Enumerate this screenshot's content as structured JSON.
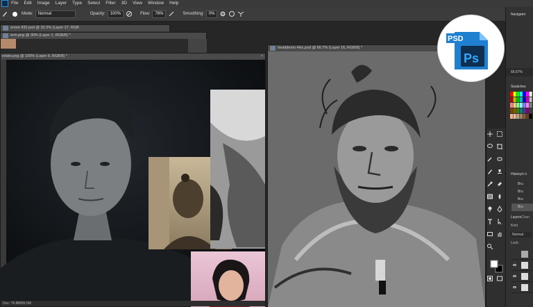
{
  "menubar": {
    "items": [
      "File",
      "Edit",
      "Image",
      "Layer",
      "Type",
      "Select",
      "Filter",
      "3D",
      "View",
      "Window",
      "Help"
    ]
  },
  "options": {
    "mode_label": "Mode:",
    "mode_value": "Normal",
    "opacity_label": "Opacity:",
    "opacity_value": "100%",
    "flow_label": "Flow:",
    "flow_value": "76%",
    "smoothing_label": "Smoothing:",
    "smoothing_value": "0%"
  },
  "tabs": {
    "back1": "eroes 432.psd @ 33.3% (Layer 27, RGB",
    "back2": "erm.png @ 30% (Layer 1, RGB/8) *",
    "ref": "erlate.png @ 100% (Layer 6, RGB/8) *",
    "sketch": "headdemo 4lec.psd @ 66.7% (Layer 16, RGB/8) *"
  },
  "status": {
    "doc": "Doc: 76.8M/65.5M"
  },
  "panels": {
    "navigator": "Navigator",
    "zoom": "66.67%",
    "swatches": "Swatches",
    "history": "History",
    "history_tab2": "Acti",
    "history_item": "Bru",
    "layers": "Layers",
    "channels": "Chan",
    "kind": "Kind",
    "blend": "Normal",
    "lock": "Lock:"
  },
  "badge": {
    "psd": "PSD",
    "ps": "Ps"
  },
  "colors": {
    "ps_blue": "#0e2f4f",
    "ps_light": "#31a8ff",
    "badge_icon": "#1f7fd0"
  }
}
